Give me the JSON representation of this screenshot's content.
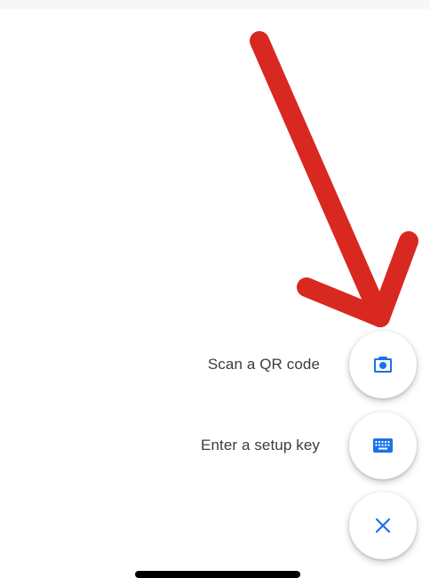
{
  "actions": [
    {
      "id": "scan",
      "label": "Scan a QR code",
      "icon": "camera-icon"
    },
    {
      "id": "setup_key",
      "label": "Enter a setup key",
      "icon": "keyboard-icon"
    }
  ],
  "close_icon": "close-icon",
  "annotation": {
    "type": "arrow",
    "color": "#d8281f",
    "points_to": "Scan a QR code"
  },
  "colors": {
    "accent": "#1a73e8",
    "label_text": "#3c3c3c",
    "background": "#ffffff",
    "arrow": "#d8281f"
  }
}
